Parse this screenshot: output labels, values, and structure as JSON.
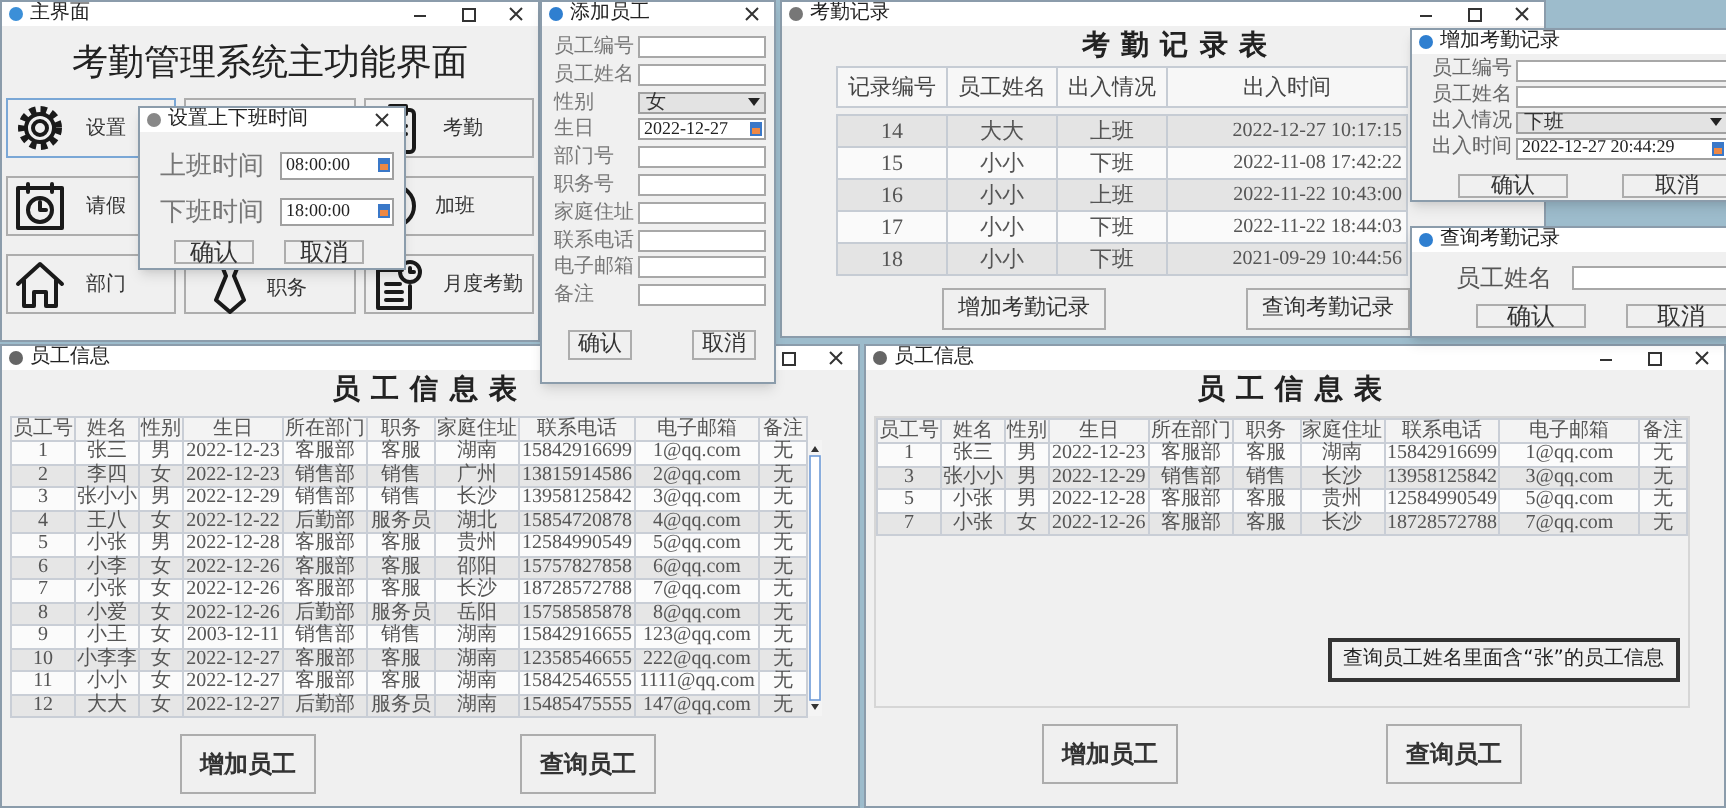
{
  "main_window": {
    "title": "主界面",
    "heading": "考勤管理系统主功能界面",
    "buttons": [
      {
        "kind": "button",
        "label": "设置"
      },
      {
        "kind": "covered"
      },
      {
        "kind": "button",
        "label": "考勤"
      },
      {
        "kind": "button",
        "label": "请假"
      },
      {
        "kind": "button",
        "label": "加班"
      },
      {
        "kind": "button",
        "label": "部门"
      },
      {
        "kind": "button",
        "label": "职务"
      },
      {
        "kind": "button",
        "label": "月度考勤"
      }
    ]
  },
  "time_dialog": {
    "title": "设置上下班时间",
    "fields": [
      {
        "label": "上班时间",
        "value": "08:00:00"
      },
      {
        "label": "下班时间",
        "value": "18:00:00"
      }
    ],
    "buttons": [
      "确认",
      "取消"
    ]
  },
  "attendance_window": {
    "title": "考勤记录",
    "heading": "考勤记录表",
    "columns": [
      "记录编号",
      "员工姓名",
      "出入情况",
      "出入时间"
    ],
    "rows": [
      [
        "14",
        "大大",
        "上班",
        "2022-12-27 10:17:15"
      ],
      [
        "15",
        "小小",
        "下班",
        "2022-11-08 17:42:22"
      ],
      [
        "16",
        "小小",
        "上班",
        "2022-11-22 10:43:00"
      ],
      [
        "17",
        "小小",
        "下班",
        "2022-11-22 18:44:03"
      ],
      [
        "18",
        "小小",
        "下班",
        "2021-09-29 10:44:56"
      ]
    ],
    "buttons": [
      "增加考勤记录",
      "查询考勤记录"
    ]
  },
  "add_attendance_dialog": {
    "title": "增加考勤记录",
    "fields": [
      {
        "label": "员工编号",
        "kind": "text"
      },
      {
        "label": "员工姓名",
        "kind": "text"
      },
      {
        "label": "出入情况",
        "kind": "select",
        "value": "下班"
      },
      {
        "label": "出入时间",
        "kind": "date",
        "value": "2022-12-27 20:44:29"
      }
    ],
    "buttons": [
      "确认",
      "取消"
    ]
  },
  "query_attendance_dialog": {
    "title": "查询考勤记录",
    "fields": [
      {
        "label": "员工姓名",
        "kind": "text"
      }
    ],
    "buttons": [
      "确认",
      "取消"
    ]
  },
  "employee_window_left": {
    "title": "员工信息",
    "heading": "员工信息表",
    "columns": [
      "员工号",
      "姓名",
      "性别",
      "生日",
      "所在部门",
      "职务",
      "家庭住址",
      "联系电话",
      "电子邮箱",
      "备注"
    ],
    "rows": [
      [
        "1",
        "张三",
        "男",
        "2022-12-23",
        "客服部",
        "客服",
        "湖南",
        "15842916699",
        "1@qq.com",
        "无"
      ],
      [
        "2",
        "李四",
        "女",
        "2022-12-23",
        "销售部",
        "销售",
        "广州",
        "13815914586",
        "2@qq.com",
        "无"
      ],
      [
        "3",
        "张小小",
        "男",
        "2022-12-29",
        "销售部",
        "销售",
        "长沙",
        "13958125842",
        "3@qq.com",
        "无"
      ],
      [
        "4",
        "王八",
        "女",
        "2022-12-22",
        "后勤部",
        "服务员",
        "湖北",
        "15854720878",
        "4@qq.com",
        "无"
      ],
      [
        "5",
        "小张",
        "男",
        "2022-12-28",
        "客服部",
        "客服",
        "贵州",
        "12584990549",
        "5@qq.com",
        "无"
      ],
      [
        "6",
        "小李",
        "女",
        "2022-12-26",
        "客服部",
        "客服",
        "邵阳",
        "15757827858",
        "6@qq.com",
        "无"
      ],
      [
        "7",
        "小张",
        "女",
        "2022-12-26",
        "客服部",
        "客服",
        "长沙",
        "18728572788",
        "7@qq.com",
        "无"
      ],
      [
        "8",
        "小爱",
        "女",
        "2022-12-26",
        "后勤部",
        "服务员",
        "岳阳",
        "15758585878",
        "8@qq.com",
        "无"
      ],
      [
        "9",
        "小王",
        "女",
        "2003-12-11",
        "销售部",
        "销售",
        "湖南",
        "15842916655",
        "123@qq.com",
        "无"
      ],
      [
        "10",
        "小李李",
        "女",
        "2022-12-27",
        "客服部",
        "客服",
        "湖南",
        "12358546655",
        "222@qq.com",
        "无"
      ],
      [
        "11",
        "小小",
        "女",
        "2022-12-27",
        "客服部",
        "客服",
        "湖南",
        "15842546555",
        "1111@qq.com",
        "无"
      ],
      [
        "12",
        "大大",
        "女",
        "2022-12-27",
        "后勤部",
        "服务员",
        "湖南",
        "15485475555",
        "147@qq.com",
        "无"
      ]
    ],
    "buttons": [
      "增加员工",
      "查询员工"
    ]
  },
  "employee_window_right": {
    "title": "员工信息",
    "heading": "员工信息表",
    "columns": [
      "员工号",
      "姓名",
      "性别",
      "生日",
      "所在部门",
      "职务",
      "家庭住址",
      "联系电话",
      "电子邮箱",
      "备注"
    ],
    "rows": [
      [
        "1",
        "张三",
        "男",
        "2022-12-23",
        "客服部",
        "客服",
        "湖南",
        "15842916699",
        "1@qq.com",
        "无"
      ],
      [
        "3",
        "张小小",
        "男",
        "2022-12-29",
        "销售部",
        "销售",
        "长沙",
        "13958125842",
        "3@qq.com",
        "无"
      ],
      [
        "5",
        "小张",
        "男",
        "2022-12-28",
        "客服部",
        "客服",
        "贵州",
        "12584990549",
        "5@qq.com",
        "无"
      ],
      [
        "7",
        "小张",
        "女",
        "2022-12-26",
        "客服部",
        "客服",
        "长沙",
        "18728572788",
        "7@qq.com",
        "无"
      ]
    ],
    "note": "查询员工姓名里面含“张”的员工信息",
    "buttons": [
      "增加员工",
      "查询员工"
    ]
  },
  "add_employee_dialog": {
    "title": "添加员工",
    "fields": [
      {
        "label": "员工编号",
        "kind": "text"
      },
      {
        "label": "员工姓名",
        "kind": "text"
      },
      {
        "label": "性别",
        "kind": "select",
        "value": "女"
      },
      {
        "label": "生日",
        "kind": "date",
        "value": "2022-12-27"
      },
      {
        "label": "部门号",
        "kind": "text"
      },
      {
        "label": "职务号",
        "kind": "text"
      },
      {
        "label": "家庭住址",
        "kind": "text"
      },
      {
        "label": "联系电话",
        "kind": "text"
      },
      {
        "label": "电子邮箱",
        "kind": "text"
      },
      {
        "label": "备注",
        "kind": "text"
      }
    ],
    "buttons": [
      "确认",
      "取消"
    ]
  }
}
